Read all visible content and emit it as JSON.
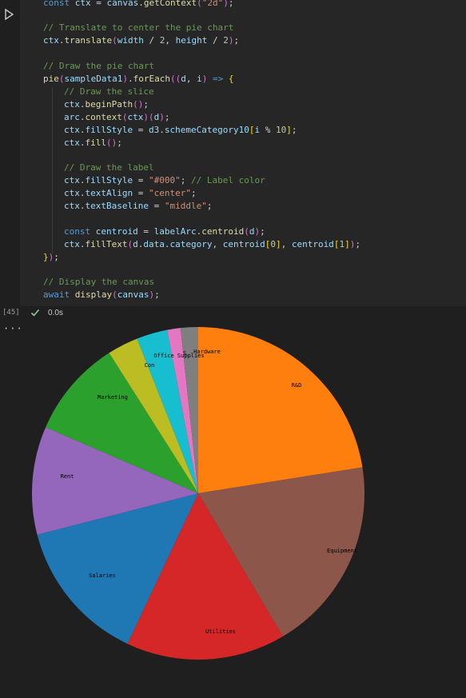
{
  "cell": {
    "execution_count": "[45]",
    "exec_time": "0.0s",
    "run_icon": "play-icon",
    "status_icon": "checkmark-icon",
    "output_menu_icon": "ellipsis-icon",
    "code_lines": [
      "const ctx = canvas.getContext(\"2d\");",
      "",
      "// Translate to center the pie chart",
      "ctx.translate(width / 2, height / 2);",
      "",
      "// Draw the pie chart",
      "pie(sampleData1).forEach((d, i) => {",
      "    // Draw the slice",
      "    ctx.beginPath();",
      "    arc.context(ctx)(d);",
      "    ctx.fillStyle = d3.schemeCategory10[i % 10];",
      "    ctx.fill();",
      "",
      "    // Draw the label",
      "    ctx.fillStyle = \"#000\"; // Label color",
      "    ctx.textAlign = \"center\";",
      "    ctx.textBaseline = \"middle\";",
      "",
      "    const centroid = labelArc.centroid(d);",
      "    ctx.fillText(d.data.category, centroid[0], centroid[1]);",
      "});",
      "",
      "// Display the canvas",
      "await display(canvas);"
    ]
  },
  "chart_data": {
    "type": "pie",
    "categories": [
      "R&D",
      "Equipment",
      "Utilities",
      "Salaries",
      "Rent",
      "Marketing",
      "Consulting",
      "Office Supplies",
      "S",
      "Hardware"
    ],
    "values": [
      22.5,
      19.0,
      15.5,
      14.0,
      10.5,
      9.5,
      3.0,
      3.0,
      1.3,
      1.7
    ],
    "colors": [
      "#ff7f0e",
      "#8c564b",
      "#d62728",
      "#1f77b4",
      "#9467bd",
      "#2ca02c",
      "#bcbd22",
      "#17becf",
      "#e377c2",
      "#7f7f7f"
    ],
    "visible_labels": [
      "R&D",
      "Equipment",
      "Utilities",
      "Salaries",
      "Rent",
      "Marketing",
      "Con",
      "Office Supplies",
      "S",
      "Hardware"
    ],
    "start": "12 o'clock",
    "direction": "clockwise"
  }
}
